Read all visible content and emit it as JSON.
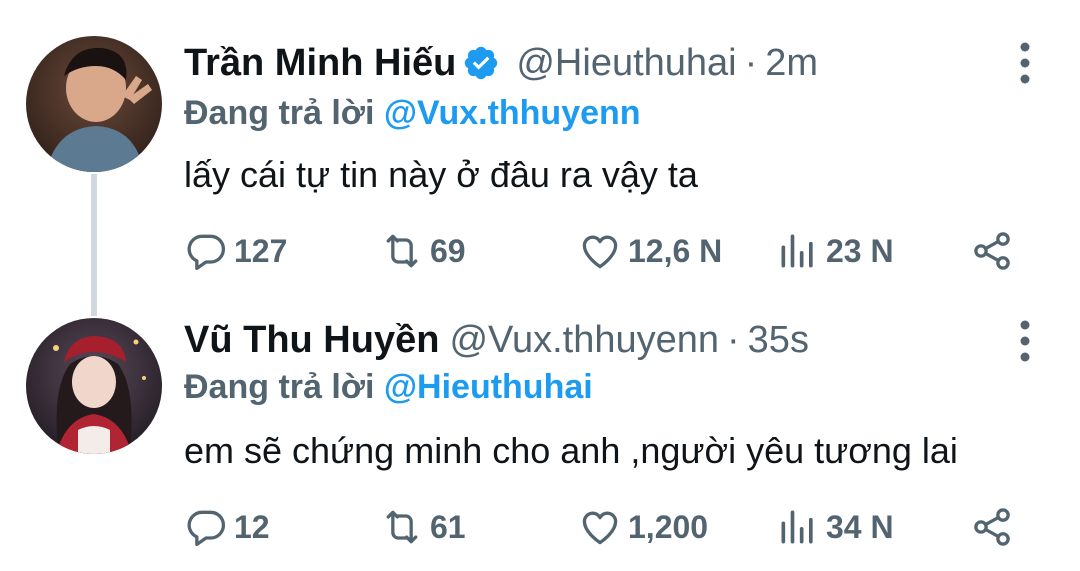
{
  "tweets": [
    {
      "display_name": "Trần Minh Hiếu",
      "verified": true,
      "handle": "@Hieuthuhai",
      "separator": "·",
      "time": "2m",
      "reply_prefix": "Đang trả lời",
      "reply_to": "@Vux.thhuyenn",
      "text": "lấy cái tự tin này ở đâu ra vậy ta",
      "replies": "127",
      "retweets": "69",
      "likes": "12,6 N",
      "views": "23 N",
      "avatar_icon": "avatar-photo-icon"
    },
    {
      "display_name": "Vũ Thu Huyền",
      "verified": false,
      "handle": "@Vux.thhuyenn",
      "separator": "·",
      "time": "35s",
      "reply_prefix": "Đang trả lời",
      "reply_to": "@Hieuthuhai",
      "text": "em sẽ chứng minh cho anh ,người yêu tương lai",
      "replies": "12",
      "retweets": "61",
      "likes": "1,200",
      "views": "34 N",
      "avatar_icon": "avatar-photo-icon"
    }
  ],
  "colors": {
    "primary_text": "#0f1419",
    "secondary_text": "#536471",
    "link_blue": "#1d9bf0",
    "thread_line": "#cfd9de"
  }
}
